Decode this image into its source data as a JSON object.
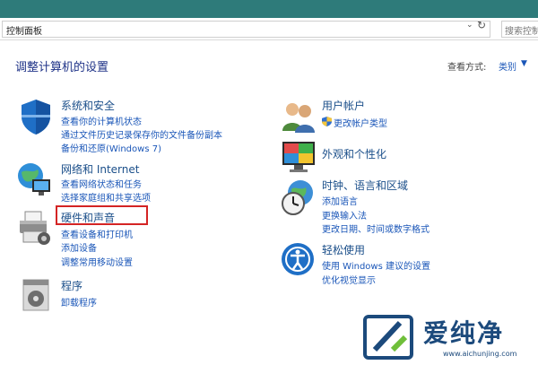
{
  "address": {
    "path": "控制面板",
    "search_placeholder": "搜索控制面板"
  },
  "header": {
    "title": "调整计算机的设置",
    "view_by_label": "查看方式:",
    "view_by_value": "类别"
  },
  "categories": [
    {
      "title": "系统和安全",
      "links": [
        "查看你的计算机状态",
        "通过文件历史记录保存你的文件备份副本",
        "备份和还原(Windows 7)"
      ]
    },
    {
      "title": "网络和 Internet",
      "links": [
        "查看网络状态和任务",
        "选择家庭组和共享选项"
      ]
    },
    {
      "title": "硬件和声音",
      "links": [
        "查看设备和打印机",
        "添加设备",
        "调整常用移动设置"
      ]
    },
    {
      "title": "程序",
      "links": [
        "卸载程序"
      ]
    },
    {
      "title": "用户帐户",
      "links": [
        "更改帐户类型"
      ]
    },
    {
      "title": "外观和个性化",
      "links": []
    },
    {
      "title": "时钟、语言和区域",
      "links": [
        "添加语言",
        "更换输入法",
        "更改日期、时间或数字格式"
      ]
    },
    {
      "title": "轻松使用",
      "links": [
        "使用 Windows 建议的设置",
        "优化视觉显示"
      ]
    }
  ],
  "watermark": {
    "text": "爱纯净",
    "url": "www.aichunjing.com"
  },
  "colors": {
    "accent": "#2e7b7a",
    "link": "#1a56b8",
    "highlight": "#d42424"
  }
}
